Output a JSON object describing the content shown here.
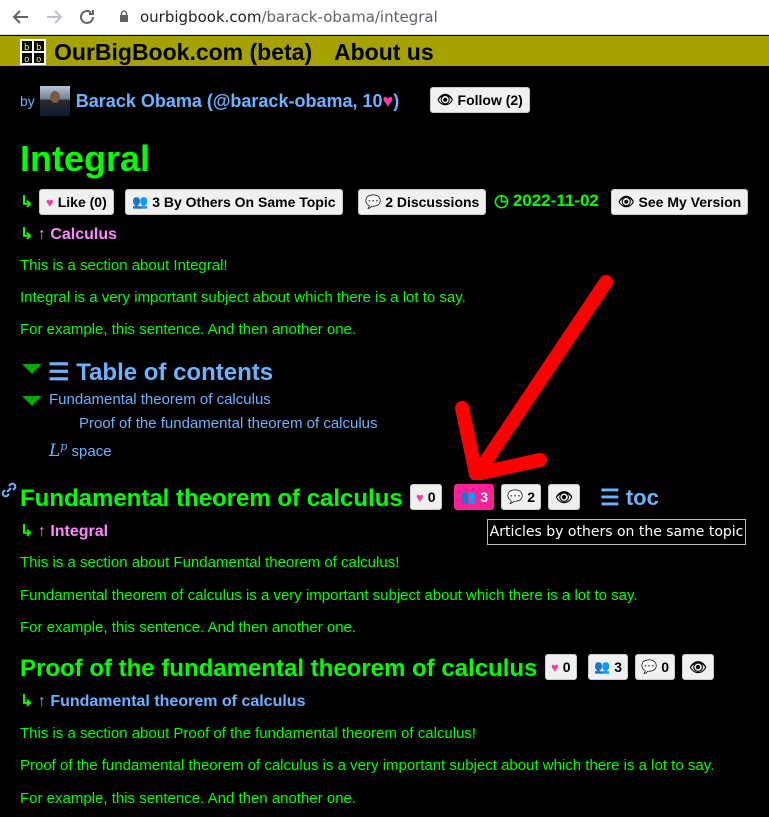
{
  "browser": {
    "url_domain": "ourbigbook.com",
    "url_path": "/barack-obama/integral"
  },
  "site": {
    "title": "OurBigBook.com (beta)",
    "about": "About us"
  },
  "author": {
    "by": "by",
    "name": "Barack Obama (@barack-obama, 10",
    "name_end": ")",
    "follow": "Follow (2)"
  },
  "article": {
    "title": "Integral",
    "like": "Like (0)",
    "others": "3 By Others On Same Topic",
    "discussions": "2 Discussions",
    "date": "2022-11-02",
    "see_version": "See My Version",
    "parent": "Calculus",
    "paragraphs": [
      "This is a section about Integral!",
      "Integral is a very important subject about which there is a lot to say.",
      "For example, this sentence. And then another one."
    ]
  },
  "toc": {
    "title": "Table of contents",
    "items": [
      "Fundamental theorem of calculus",
      "Proof of the fundamental theorem of calculus",
      "space"
    ],
    "lp": "L",
    "lp_sup": "p"
  },
  "section1": {
    "title": "Fundamental theorem of calculus",
    "likes": "0",
    "others": "3",
    "discussions": "2",
    "toc_link": "toc",
    "tooltip": "Articles by others on the same topic",
    "parent": "Integral",
    "paragraphs": [
      "This is a section about Fundamental theorem of calculus!",
      "Fundamental theorem of calculus is a very important subject about which there is a lot to say.",
      "For example, this sentence. And then another one."
    ]
  },
  "section2": {
    "title": "Proof of the fundamental theorem of calculus",
    "likes": "0",
    "others": "3",
    "discussions": "0",
    "parent": "Fundamental theorem of calculus",
    "paragraphs": [
      "This is a section about Proof of the fundamental theorem of calculus!",
      "Proof of the fundamental theorem of calculus is a very important subject about which there is a lot to say.",
      "For example, this sentence. And then another one."
    ]
  },
  "colors": {
    "header": "#a5a200",
    "green": "#00ff00",
    "blue": "#6cb2ff",
    "pink": "#ff1f97",
    "arrow": "#ff0000"
  }
}
